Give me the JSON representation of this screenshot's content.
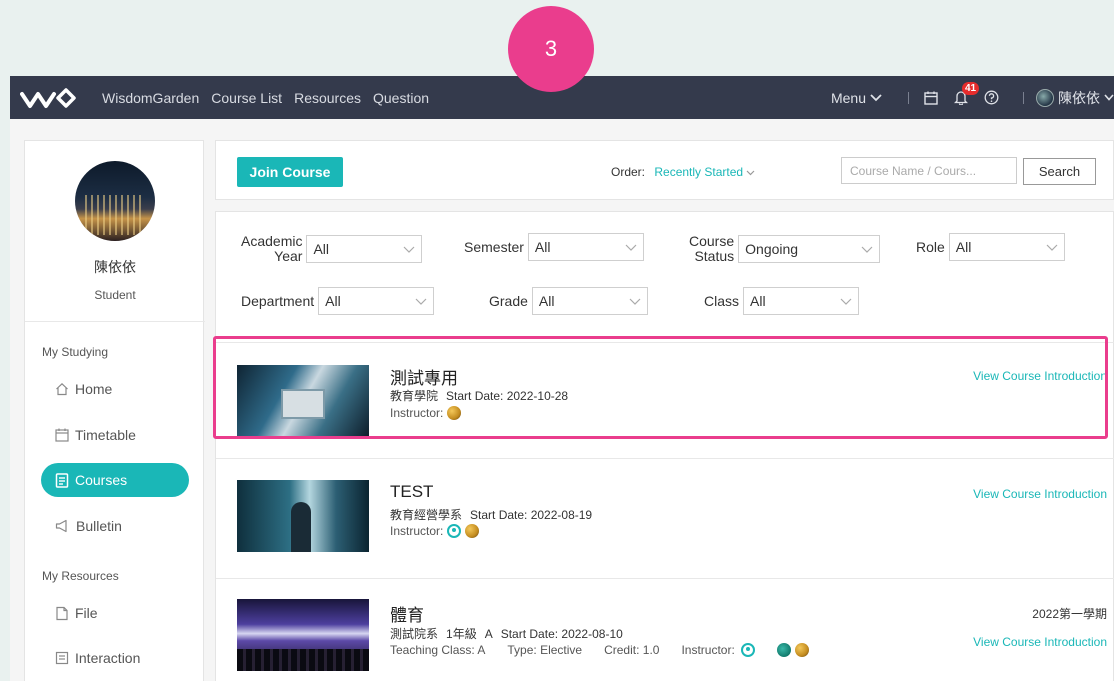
{
  "step_badge": "3",
  "topbar": {
    "brand": "WisdomGarden",
    "nav": [
      "Course List",
      "Resources",
      "Question"
    ],
    "menu_label": "Menu",
    "notification_count": "41",
    "user_name": "陳依依"
  },
  "sidebar": {
    "user_name": "陳依依",
    "role": "Student",
    "section_studying": "My Studying",
    "items_studying": [
      "Home",
      "Timetable",
      "Courses",
      "Bulletin"
    ],
    "active_item": "Courses",
    "section_resources": "My Resources",
    "items_resources": [
      "File",
      "Interaction"
    ]
  },
  "toolbar": {
    "join_label": "Join Course",
    "order_label": "Order:",
    "order_value": "Recently Started",
    "search_placeholder": "Course Name / Cours...",
    "search_label": "Search"
  },
  "filters": {
    "academic_year_l1": "Academic",
    "academic_year_l2": "Year",
    "academic_year_value": "All",
    "semester_label": "Semester",
    "semester_value": "All",
    "course_status_l1": "Course",
    "course_status_l2": "Status",
    "course_status_value": "Ongoing",
    "role_label": "Role",
    "role_value": "All",
    "department_label": "Department",
    "department_value": "All",
    "grade_label": "Grade",
    "grade_value": "All",
    "class_label": "Class",
    "class_value": "All"
  },
  "courses": [
    {
      "title": "測試專用",
      "department": "教育學院",
      "start_date": "Start Date: 2022-10-28",
      "instructor_label": "Instructor:",
      "link": "View Course Introduction"
    },
    {
      "title": "TEST",
      "department": "教育經營學系",
      "start_date": "Start Date: 2022-08-19",
      "instructor_label": "Instructor:",
      "link": "View Course Introduction"
    },
    {
      "title": "體育",
      "department": "測試院系",
      "grade": "1年級",
      "class": "A",
      "start_date": "Start Date: 2022-08-10",
      "teaching_class": "Teaching Class: A",
      "type": "Type: Elective",
      "credit": "Credit: 1.0",
      "instructor_label": "Instructor:",
      "term": "2022第一學期",
      "link": "View Course Introduction"
    }
  ],
  "colors": {
    "accent": "#1ab7b7",
    "highlight": "#ea3d8d",
    "topbar": "#343a4c"
  }
}
